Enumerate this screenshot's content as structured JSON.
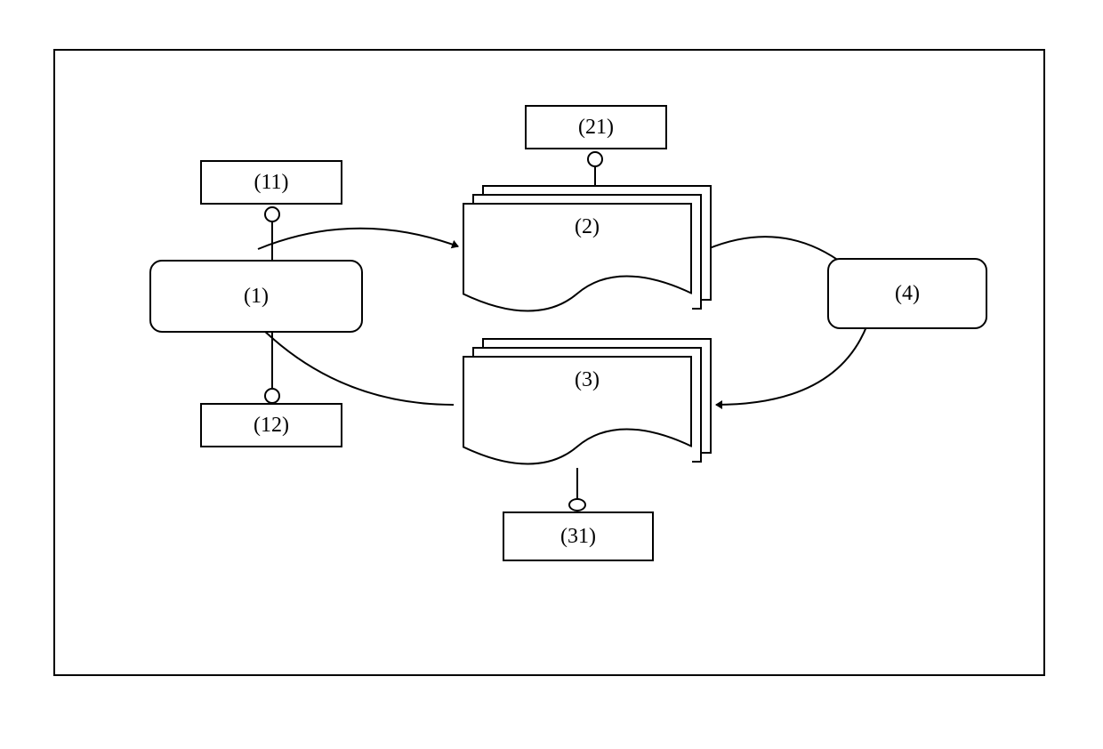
{
  "nodes": {
    "n1": {
      "label": "(1)"
    },
    "n11": {
      "label": "(11)"
    },
    "n12": {
      "label": "(12)"
    },
    "n2": {
      "label": "(2)"
    },
    "n21": {
      "label": "(21)"
    },
    "n3": {
      "label": "(3)"
    },
    "n31": {
      "label": "(31)"
    },
    "n4": {
      "label": "(4)"
    }
  }
}
